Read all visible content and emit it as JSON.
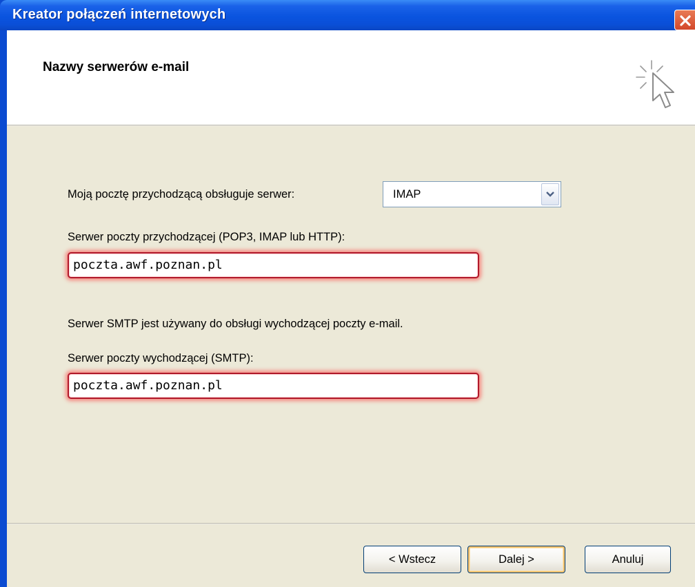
{
  "window": {
    "title": "Kreator połączeń internetowych",
    "close_icon": "close-icon"
  },
  "header": {
    "title": "Nazwy serwerów e-mail",
    "icon": "wizard-cursor-icon"
  },
  "form": {
    "incoming_type_label": "Moją pocztę przychodzącą obsługuje serwer:",
    "incoming_type_value": "IMAP",
    "incoming_server_label": "Serwer poczty przychodzącej (POP3, IMAP lub HTTP):",
    "incoming_server_value": "poczta.awf.poznan.pl",
    "smtp_info": "Serwer SMTP jest używany do obsługi wychodzącej poczty e-mail.",
    "outgoing_server_label": "Serwer poczty wychodzącej (SMTP):",
    "outgoing_server_value": "poczta.awf.poznan.pl"
  },
  "buttons": {
    "back": "< Wstecz",
    "next": "Dalej >",
    "cancel": "Anuluj"
  },
  "colors": {
    "titlebar": "#0a54df",
    "dialog_bg": "#ece9d8",
    "highlight": "#ff3c3c"
  }
}
